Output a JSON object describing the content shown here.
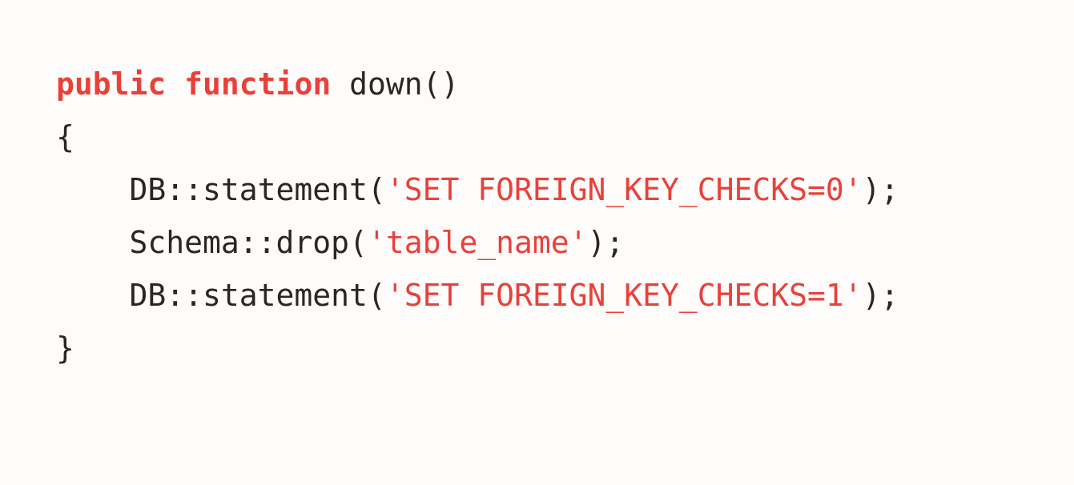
{
  "code": {
    "line1": {
      "keyword1": "public",
      "space1": " ",
      "keyword2": "function",
      "rest": " down()"
    },
    "line2": {
      "text": "{"
    },
    "line3": {
      "indent": "    ",
      "prefix": "DB::statement(",
      "string": "'SET FOREIGN_KEY_CHECKS=0'",
      "suffix": ");"
    },
    "line4": {
      "indent": "    ",
      "prefix": "Schema::drop(",
      "string": "'table_name'",
      "suffix": ");"
    },
    "line5": {
      "indent": "    ",
      "prefix": "DB::statement(",
      "string": "'SET FOREIGN_KEY_CHECKS=1'",
      "suffix": ");"
    },
    "line6": {
      "text": "}"
    }
  },
  "colors": {
    "keyword": "#e8413a",
    "string": "#e8413a",
    "text": "#2a2624",
    "background": "#fdfcfb"
  }
}
